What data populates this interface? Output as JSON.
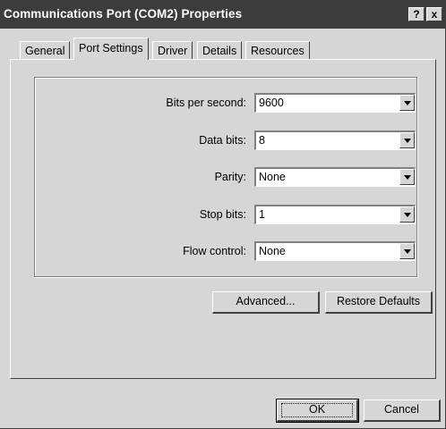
{
  "window": {
    "title": "Communications Port (COM2) Properties",
    "help_glyph": "?",
    "close_glyph": "x"
  },
  "tabs": [
    {
      "label": "General",
      "active": false
    },
    {
      "label": "Port Settings",
      "active": true
    },
    {
      "label": "Driver",
      "active": false
    },
    {
      "label": "Details",
      "active": false
    },
    {
      "label": "Resources",
      "active": false
    }
  ],
  "settings": {
    "bits_per_second": {
      "label": "Bits per second:",
      "value": "9600"
    },
    "data_bits": {
      "label": "Data bits:",
      "value": "8"
    },
    "parity": {
      "label": "Parity:",
      "value": "None"
    },
    "stop_bits": {
      "label": "Stop bits:",
      "value": "1"
    },
    "flow_control": {
      "label": "Flow control:",
      "value": "None"
    }
  },
  "buttons": {
    "advanced": "Advanced...",
    "restore_defaults": "Restore Defaults",
    "ok": "OK",
    "cancel": "Cancel"
  },
  "icons": {
    "help": "question-mark-icon",
    "close": "close-icon",
    "dropdown": "chevron-down-icon"
  },
  "colors": {
    "titlebar": "#3c3c3c",
    "face": "#d6d6d6"
  }
}
